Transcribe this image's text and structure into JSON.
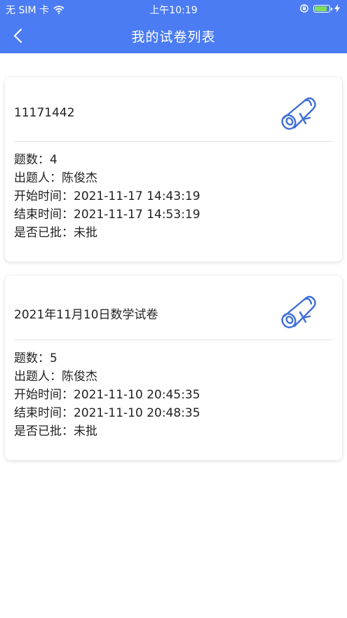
{
  "status_bar": {
    "carrier": "无 SIM 卡",
    "time": "上午10:19",
    "battery_percent": 85
  },
  "nav": {
    "title": "我的试卷列表",
    "back_icon": "chevron-left-icon"
  },
  "exams": [
    {
      "title": "11171442",
      "icon": "scroll-certificate-icon",
      "count_label": "题数：",
      "count": "4",
      "author_label": "出题人：",
      "author": "陈俊杰",
      "start_label": "开始时间：",
      "start": "2021-11-17 14:43:19",
      "end_label": "结束时间：",
      "end": "2021-11-17 14:53:19",
      "graded_label": "是否已批：",
      "graded": "未批"
    },
    {
      "title": "2021年11月10日数学试卷",
      "icon": "scroll-certificate-icon",
      "count_label": "题数：",
      "count": "5",
      "author_label": "出题人：",
      "author": "陈俊杰",
      "start_label": "开始时间：",
      "start": "2021-11-10 20:45:35",
      "end_label": "结束时间：",
      "end": "2021-11-10 20:48:35",
      "graded_label": "是否已批：",
      "graded": "未批"
    }
  ],
  "colors": {
    "primary": "#4c7cf3",
    "icon_stroke": "#3f6fd6",
    "battery_fill": "#7ee05a"
  }
}
